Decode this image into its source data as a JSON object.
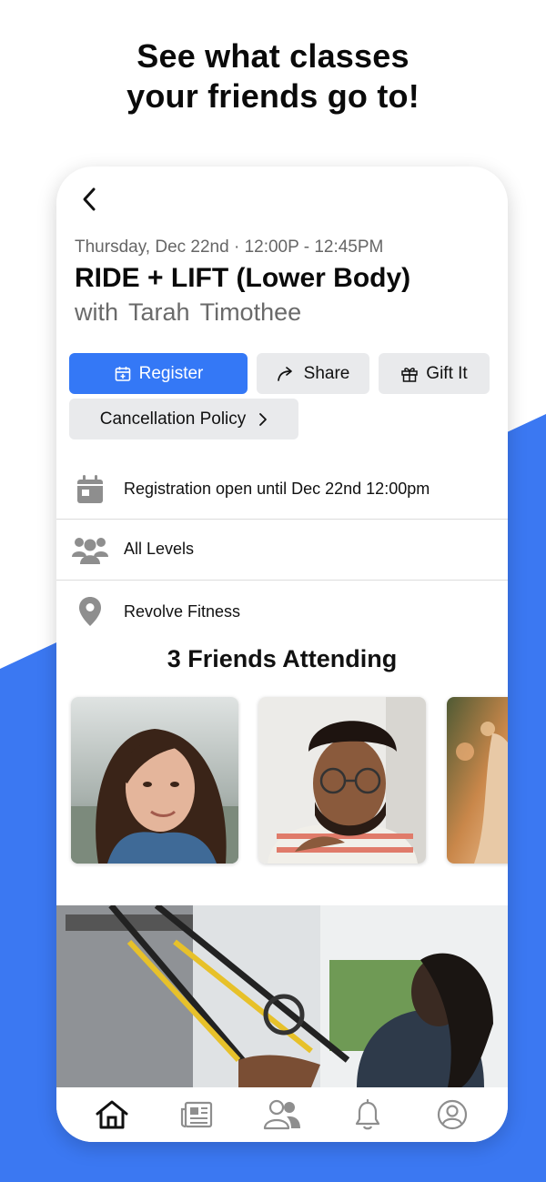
{
  "headline": {
    "line1": "See what classes",
    "line2": "your friends go to!"
  },
  "colors": {
    "accent": "#3478f6",
    "background_blue": "#3b78f2",
    "button_gray": "#e9eaec",
    "icon_gray": "#8e8e8e"
  },
  "class": {
    "datetime": "Thursday, Dec 22nd · 12:00P - 12:45PM",
    "title": "RIDE + LIFT (Lower Body)",
    "instructor": "with Tarah  Timothee"
  },
  "actions": {
    "register_label": "Register",
    "share_label": "Share",
    "gift_label": "Gift It",
    "cancellation_label": "Cancellation Policy"
  },
  "details": [
    {
      "icon": "calendar-icon",
      "text": "Registration open until Dec 22nd 12:00pm"
    },
    {
      "icon": "group-icon",
      "text": "All Levels"
    },
    {
      "icon": "location-pin-icon",
      "text": "Revolve Fitness"
    }
  ],
  "friends": {
    "title": "3 Friends Attending",
    "avatars": [
      "friend-photo-woman",
      "friend-photo-man-glasses",
      "friend-photo-partial"
    ]
  },
  "tabbar": {
    "items": [
      "home-icon",
      "news-icon",
      "friends-icon",
      "bell-icon",
      "profile-icon"
    ],
    "active": "home-icon"
  }
}
